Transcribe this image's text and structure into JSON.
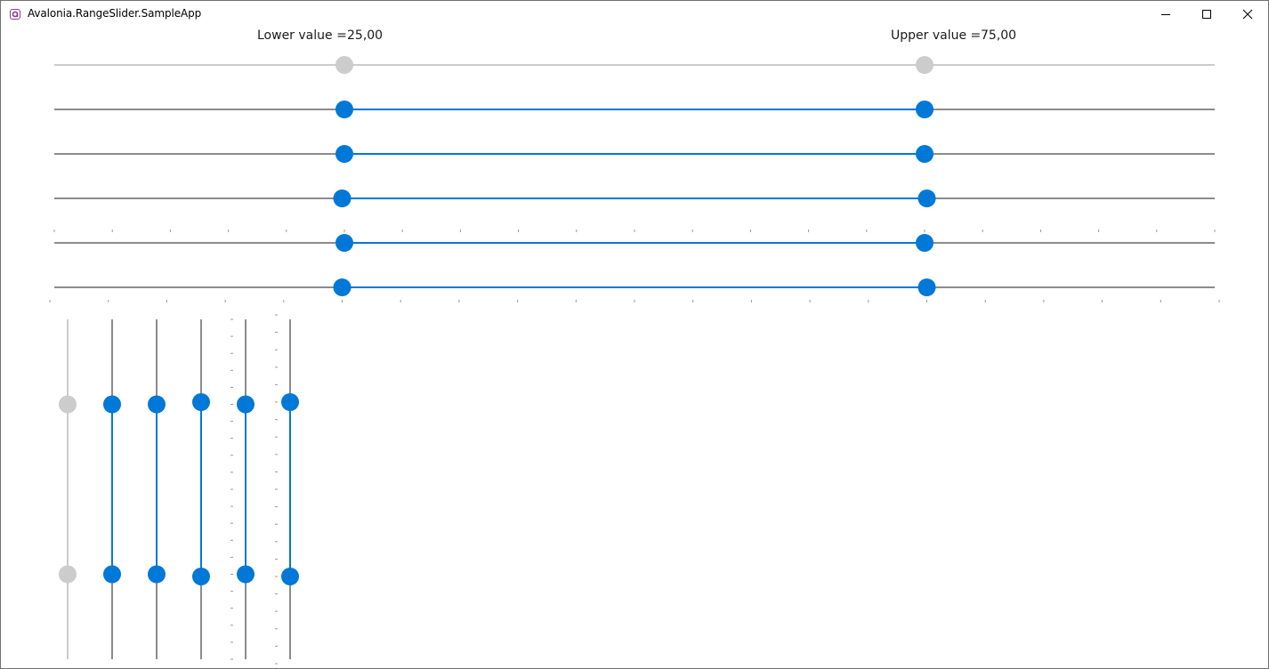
{
  "window": {
    "title": "Avalonia.RangeSlider.SampleApp",
    "controls": {
      "minimize": "minimize-icon",
      "maximize": "maximize-icon",
      "close": "close-icon"
    }
  },
  "labels": {
    "lower_label": "Lower value =",
    "lower_value": "25,00",
    "upper_label": "Upper value =",
    "upper_value": "75,00"
  },
  "colors": {
    "accent": "#0078d7",
    "track": "#8c8c8c",
    "disabled_track": "#cccccc",
    "disabled_thumb": "#cccccc"
  },
  "range": {
    "minimum": 0,
    "maximum": 100,
    "lower": 25,
    "upper": 75
  },
  "horizontal_sliders": [
    {
      "name": "horizontal-slider-disabled",
      "enabled": false,
      "ticks": "none"
    },
    {
      "name": "horizontal-slider-1",
      "enabled": true,
      "ticks": "none"
    },
    {
      "name": "horizontal-slider-2",
      "enabled": true,
      "ticks": "none"
    },
    {
      "name": "horizontal-slider-3",
      "enabled": true,
      "ticks": "none"
    },
    {
      "name": "horizontal-slider-ticks-top",
      "enabled": true,
      "ticks": "top"
    },
    {
      "name": "horizontal-slider-ticks-bottom",
      "enabled": true,
      "ticks": "bottom"
    }
  ],
  "vertical_sliders": [
    {
      "name": "vertical-slider-disabled",
      "enabled": false,
      "ticks": "none"
    },
    {
      "name": "vertical-slider-1",
      "enabled": true,
      "ticks": "none"
    },
    {
      "name": "vertical-slider-2",
      "enabled": true,
      "ticks": "none"
    },
    {
      "name": "vertical-slider-3",
      "enabled": true,
      "ticks": "none"
    },
    {
      "name": "vertical-slider-ticks-left",
      "enabled": true,
      "ticks": "left"
    },
    {
      "name": "vertical-slider-ticks-right",
      "enabled": true,
      "ticks": "right"
    }
  ]
}
